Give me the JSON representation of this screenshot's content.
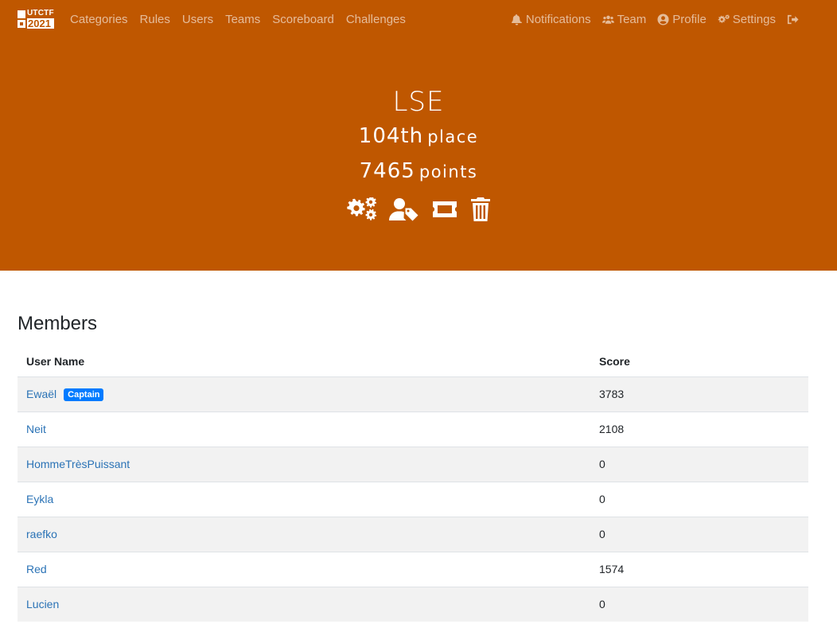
{
  "brand": {
    "line1": "UTCTF",
    "line2": "2021"
  },
  "nav": {
    "left": [
      "Categories",
      "Rules",
      "Users",
      "Teams",
      "Scoreboard",
      "Challenges"
    ],
    "notifications": "Notifications",
    "team": "Team",
    "profile": "Profile",
    "settings": "Settings"
  },
  "team": {
    "name": "LSE",
    "rank_value": "104th",
    "rank_label": "place",
    "points_value": "7465",
    "points_label": "points"
  },
  "icons": {
    "actions": [
      "gears-icon",
      "user-tag-icon",
      "ticket-icon",
      "trash-icon"
    ],
    "nav": [
      "bell-icon",
      "users-icon",
      "user-circle-icon",
      "cogs-icon",
      "sign-out-icon"
    ]
  },
  "colors": {
    "header_bg": "#bf5700",
    "link": "#2b73b6",
    "badge": "#007bff"
  },
  "members": {
    "title": "Members",
    "headers": {
      "user": "User Name",
      "score": "Score"
    },
    "rows": [
      {
        "name": "Ewaël",
        "badge": "Captain",
        "score": "3783"
      },
      {
        "name": "Neit",
        "score": "2108"
      },
      {
        "name": "HommeTrèsPuissant",
        "score": "0"
      },
      {
        "name": "Eykla",
        "score": "0"
      },
      {
        "name": "raefko",
        "score": "0"
      },
      {
        "name": "Red",
        "score": "1574"
      },
      {
        "name": "Lucien",
        "score": "0"
      }
    ]
  }
}
